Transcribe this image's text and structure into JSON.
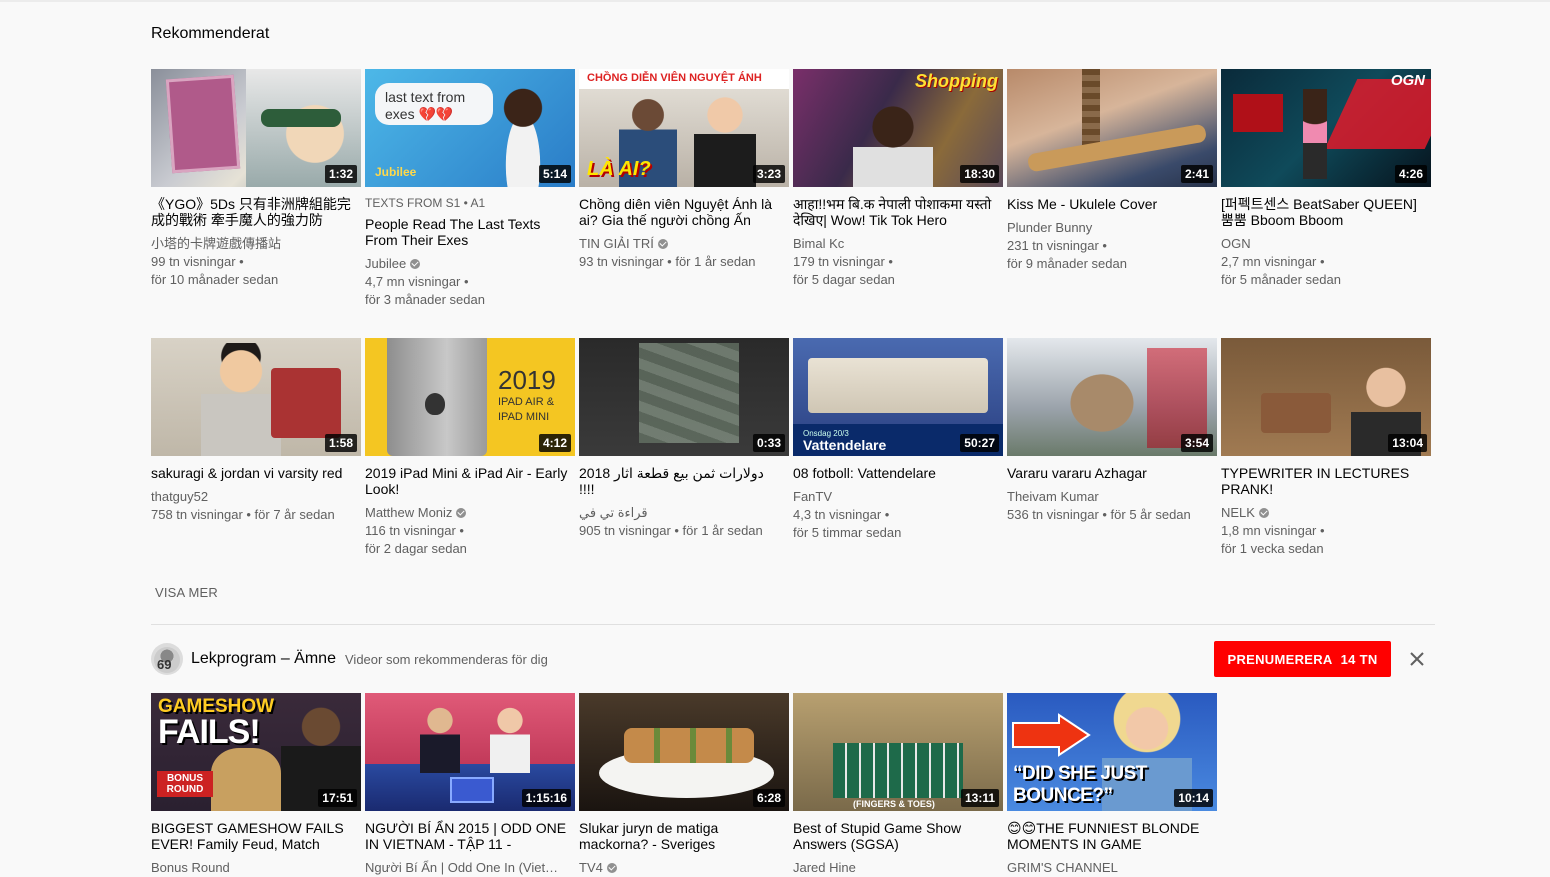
{
  "section": {
    "title": "Rekommenderat"
  },
  "row1": [
    {
      "title": "《YGO》5Ds 只有非洲牌組能完成的戰術 牽手魔人的強力防",
      "prefix": "",
      "channel": "小塔的卡牌遊戲傳播站",
      "verified": false,
      "views": "99 tn visningar •",
      "age": "för 10 månader sedan",
      "duration": "1:32"
    },
    {
      "title": "People Read The Last Texts From Their Exes",
      "prefix": "TEXTS FROM  S1 • A1",
      "channel": "Jubilee",
      "verified": true,
      "views": "4,7 mn visningar •",
      "age": "för 3 månader sedan",
      "duration": "5:14",
      "overlay": "last text from exes 💔💔",
      "brand": "Jubilee"
    },
    {
      "title": "Chồng diên viên Nguyệt Ánh là ai? Gia thế người chồng Ấn",
      "prefix": "",
      "channel": "TIN GIẢI TRÍ",
      "verified": true,
      "views": "93 tn visningar • för 1 år sedan",
      "age": "",
      "duration": "3:23",
      "overlay": "CHỒNG DIỄN VIÊN NGUYỆT ÁNH",
      "overlay2": "LÀ AI?"
    },
    {
      "title": "आहा!!भम बि.क नेपाली पोशाकमा यस्तो देखिए| Wow! Tik Tok Hero",
      "prefix": "",
      "channel": "Bimal Kc",
      "verified": false,
      "views": "179 tn visningar •",
      "age": "för 5 dagar sedan",
      "duration": "18:30",
      "overlay": "Shopping"
    },
    {
      "title": "Kiss Me - Ukulele Cover",
      "prefix": "",
      "channel": "Plunder Bunny",
      "verified": false,
      "views": "231 tn visningar •",
      "age": "för 9 månader sedan",
      "duration": "2:41"
    },
    {
      "title": "[퍼펙트센스 BeatSaber QUEEN] 뿜뿜 Bboom Bboom",
      "prefix": "",
      "channel": "OGN",
      "verified": false,
      "views": "2,7 mn visningar •",
      "age": "för 5 månader sedan",
      "duration": "4:26",
      "overlay": "OGN"
    }
  ],
  "row2": [
    {
      "title": "sakuragi & jordan vi varsity red",
      "channel": "thatguy52",
      "verified": false,
      "views": "758 tn visningar • för 7 år sedan",
      "age": "",
      "duration": "1:58"
    },
    {
      "title": "2019 iPad Mini & iPad Air - Early Look!",
      "channel": "Matthew Moniz",
      "verified": true,
      "views": "116 tn visningar •",
      "age": "för 2 dagar sedan",
      "duration": "4:12",
      "overlay": "2019",
      "overlay2": "IPAD AIR &",
      "overlay3": "IPAD MINI"
    },
    {
      "title": "2018 دولارات ثمن بيع قطعة اثار !!!!",
      "channel": "قراءة تي في",
      "verified": false,
      "views": "905 tn visningar • för 1 år sedan",
      "age": "",
      "duration": "0:33"
    },
    {
      "title": "08 fotboll: Vattendelare",
      "channel": "FanTV",
      "verified": false,
      "views": "4,3 tn visningar •",
      "age": "för 5 timmar sedan",
      "duration": "50:27",
      "overlay": "Vattendelare",
      "overlay2": "Onsdag 20/3"
    },
    {
      "title": "Vararu vararu Azhagar",
      "channel": "Theivam Kumar",
      "verified": false,
      "views": "536 tn visningar • för 5 år sedan",
      "age": "",
      "duration": "3:54"
    },
    {
      "title": "TYPEWRITER IN LECTURES PRANK!",
      "channel": "NELK",
      "verified": true,
      "views": "1,8 mn visningar •",
      "age": "för 1 vecka sedan",
      "duration": "13:04"
    }
  ],
  "show_more": "VISA MER",
  "shelf": {
    "title": "Lekprogram – Ämne",
    "subtitle": "Videor som rekommenderas för dig",
    "subscribe_label": "PRENUMERERA",
    "subscriber_count": "14 TN",
    "avatar_text": "69"
  },
  "row3": [
    {
      "title": "BIGGEST GAMESHOW FAILS EVER! Family Feud, Match",
      "channel": "Bonus Round",
      "verified": false,
      "duration": "17:51",
      "overlay": "GAMESHOW",
      "overlay2": "FAILS!",
      "overlay3": "BONUS ROUND"
    },
    {
      "title": "NGƯỜI BÍ ẨN 2015 | ODD ONE IN VIETNAM - TẬP 11 -",
      "channel": "Người Bí Ẩn | Odd One In (Viet…",
      "verified": false,
      "duration": "1:15:16"
    },
    {
      "title": "Slukar juryn de matiga mackorna? - Sveriges",
      "channel": "TV4",
      "verified": true,
      "duration": "6:28"
    },
    {
      "title": "Best of Stupid Game Show Answers (SGSA)",
      "channel": "Jared Hine",
      "verified": false,
      "duration": "13:11",
      "overlay": "(FINGERS & TOES)"
    },
    {
      "title": "😊😊THE FUNNIEST BLONDE MOMENTS IN GAME",
      "channel": "GRIM'S CHANNEL",
      "verified": false,
      "duration": "10:14",
      "overlay": "“DID SHE JUST BOUNCE?”"
    }
  ]
}
